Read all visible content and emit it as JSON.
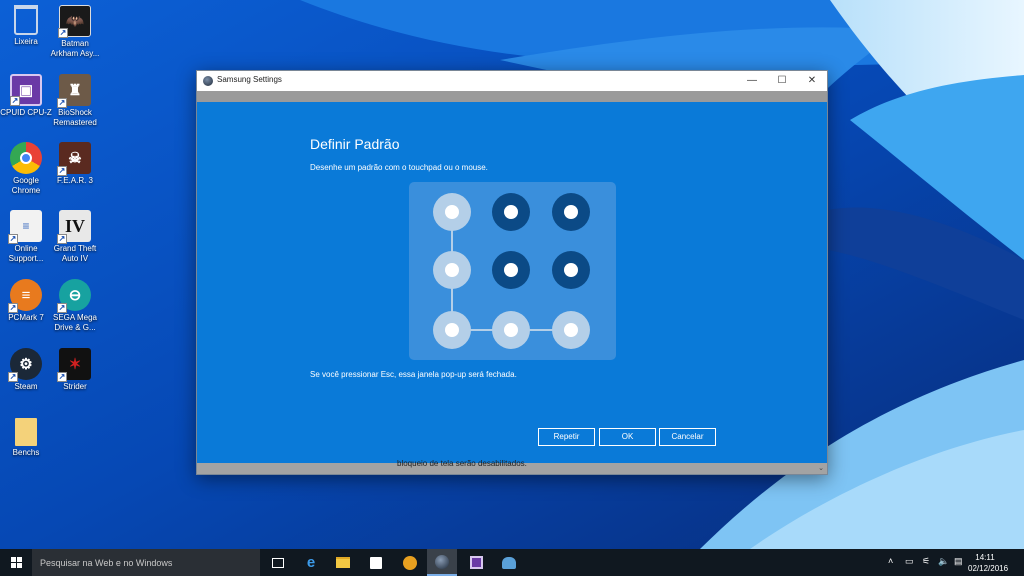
{
  "desktop_icons": [
    {
      "label": "Lixeira",
      "icon": "recycle-bin-icon",
      "color": "#b0c4de"
    },
    {
      "label": "Batman Arkham Asy...",
      "icon": "batman-icon",
      "color": "#1a1a1a"
    },
    {
      "label": "CPUID CPU-Z",
      "icon": "cpuz-icon",
      "color": "#6a3aa6"
    },
    {
      "label": "BioShock Remastered",
      "icon": "bioshock-icon",
      "color": "#6d5a48"
    },
    {
      "label": "Google Chrome",
      "icon": "chrome-icon",
      "color": "#e94235"
    },
    {
      "label": "F.E.A.R. 3",
      "icon": "fear-icon",
      "color": "#5a2a20"
    },
    {
      "label": "Online Support...",
      "icon": "document-icon",
      "color": "#f2f2f2"
    },
    {
      "label": "Grand Theft Auto IV",
      "icon": "gta-icon",
      "color": "#1c1c1c"
    },
    {
      "label": "PCMark 7",
      "icon": "pcmark-icon",
      "color": "#e87a1e"
    },
    {
      "label": "SEGA Mega Drive & G...",
      "icon": "sega-icon",
      "color": "#17a2a0"
    },
    {
      "label": "Steam",
      "icon": "steam-icon",
      "color": "#1b2838"
    },
    {
      "label": "Strider",
      "icon": "strider-icon",
      "color": "#b01818"
    },
    {
      "label": "Benchs",
      "icon": "folder-icon",
      "color": "#f4d27a"
    }
  ],
  "window": {
    "title": "Samsung Settings",
    "minimize": "—",
    "maximize": "☐",
    "close": "✕",
    "behind_text": "bloqueio de tela serão desabilitados."
  },
  "dialog": {
    "title": "Definir Padrão",
    "subtitle": "Desenhe um padrão com o touchpad ou o mouse.",
    "note": "Se você pressionar Esc, essa janela pop-up será fechada.",
    "pattern_selected": [
      1,
      4,
      7,
      8,
      9
    ],
    "buttons": {
      "repeat": "Repetir",
      "ok": "OK",
      "cancel": "Cancelar"
    }
  },
  "taskbar": {
    "search_placeholder": "Pesquisar na Web e no Windows",
    "apps": [
      "task-view-icon",
      "edge-icon",
      "file-explorer-icon",
      "store-icon",
      "tool-icon",
      "samsung-settings-icon",
      "cpuz-icon",
      "paint-icon"
    ],
    "time": "14:11",
    "date": "02/12/2016"
  },
  "colors": {
    "dialog_bg": "#0a7ad8",
    "dot_selected": "#b4cfe8",
    "dot_unselected": "#0b4a86"
  }
}
